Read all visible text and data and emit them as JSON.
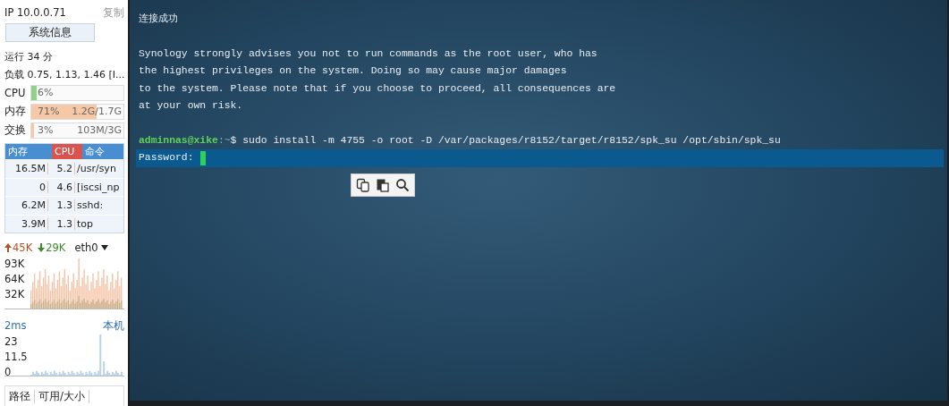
{
  "sidebar": {
    "ip": "IP 10.0.0.71",
    "copy_link": "复制",
    "sysinfo_button": "系统信息",
    "uptime": "运行 34 分",
    "load": "负载 0.75, 1.13, 1.46 [I...",
    "meters": [
      {
        "label": "CPU",
        "reading": "6%",
        "level": 0.06
      },
      {
        "label": "内存",
        "reading": "71%",
        "extra": "1.2G/1.7G",
        "level": 0.71
      },
      {
        "label": "交换",
        "reading": "3%",
        "extra": "103M/3G",
        "level": 0.03
      }
    ],
    "process_table": {
      "columns": [
        {
          "label": "内存",
          "selected": false
        },
        {
          "label": "CPU",
          "selected": true
        },
        {
          "label": "命令",
          "selected": false
        }
      ],
      "rows": [
        [
          "16.5M",
          "5.2",
          "/usr/syn"
        ],
        [
          "0",
          "4.6",
          "[iscsi_np"
        ],
        [
          "6.2M",
          "1.3",
          "sshd:"
        ],
        [
          "3.9M",
          "1.3",
          "top"
        ]
      ]
    },
    "network": {
      "upload": "45K",
      "download": "29K",
      "interface": "eth0",
      "ticks": [
        "93K",
        "64K",
        "32K"
      ]
    },
    "latency": {
      "reading": "2ms",
      "host": "本机",
      "ticks": [
        "23",
        "11.5",
        "0"
      ]
    },
    "disk_table": {
      "columns": [
        "路径",
        "可用/大小"
      ]
    }
  },
  "terminal": {
    "lines": [
      {
        "kind": "text",
        "text": "连接成功"
      },
      {
        "kind": "blank"
      },
      {
        "kind": "text",
        "text": "Synology strongly advises you not to run commands as the root user, who has"
      },
      {
        "kind": "text",
        "text": "the highest privileges on the system. Doing so may cause major damages"
      },
      {
        "kind": "text",
        "text": "to the system. Please note that if you choose to proceed, all consequences are"
      },
      {
        "kind": "text",
        "text": "at your own risk."
      },
      {
        "kind": "blank"
      },
      {
        "kind": "prompt",
        "user": "adminnas@xike",
        "path": ":~",
        "text": "$ sudo install -m 4755 -o root -D /var/packages/r8152/target/r8152/spk_su /opt/sbin/spk_su"
      },
      {
        "kind": "input",
        "text": "Password:"
      }
    ]
  }
}
